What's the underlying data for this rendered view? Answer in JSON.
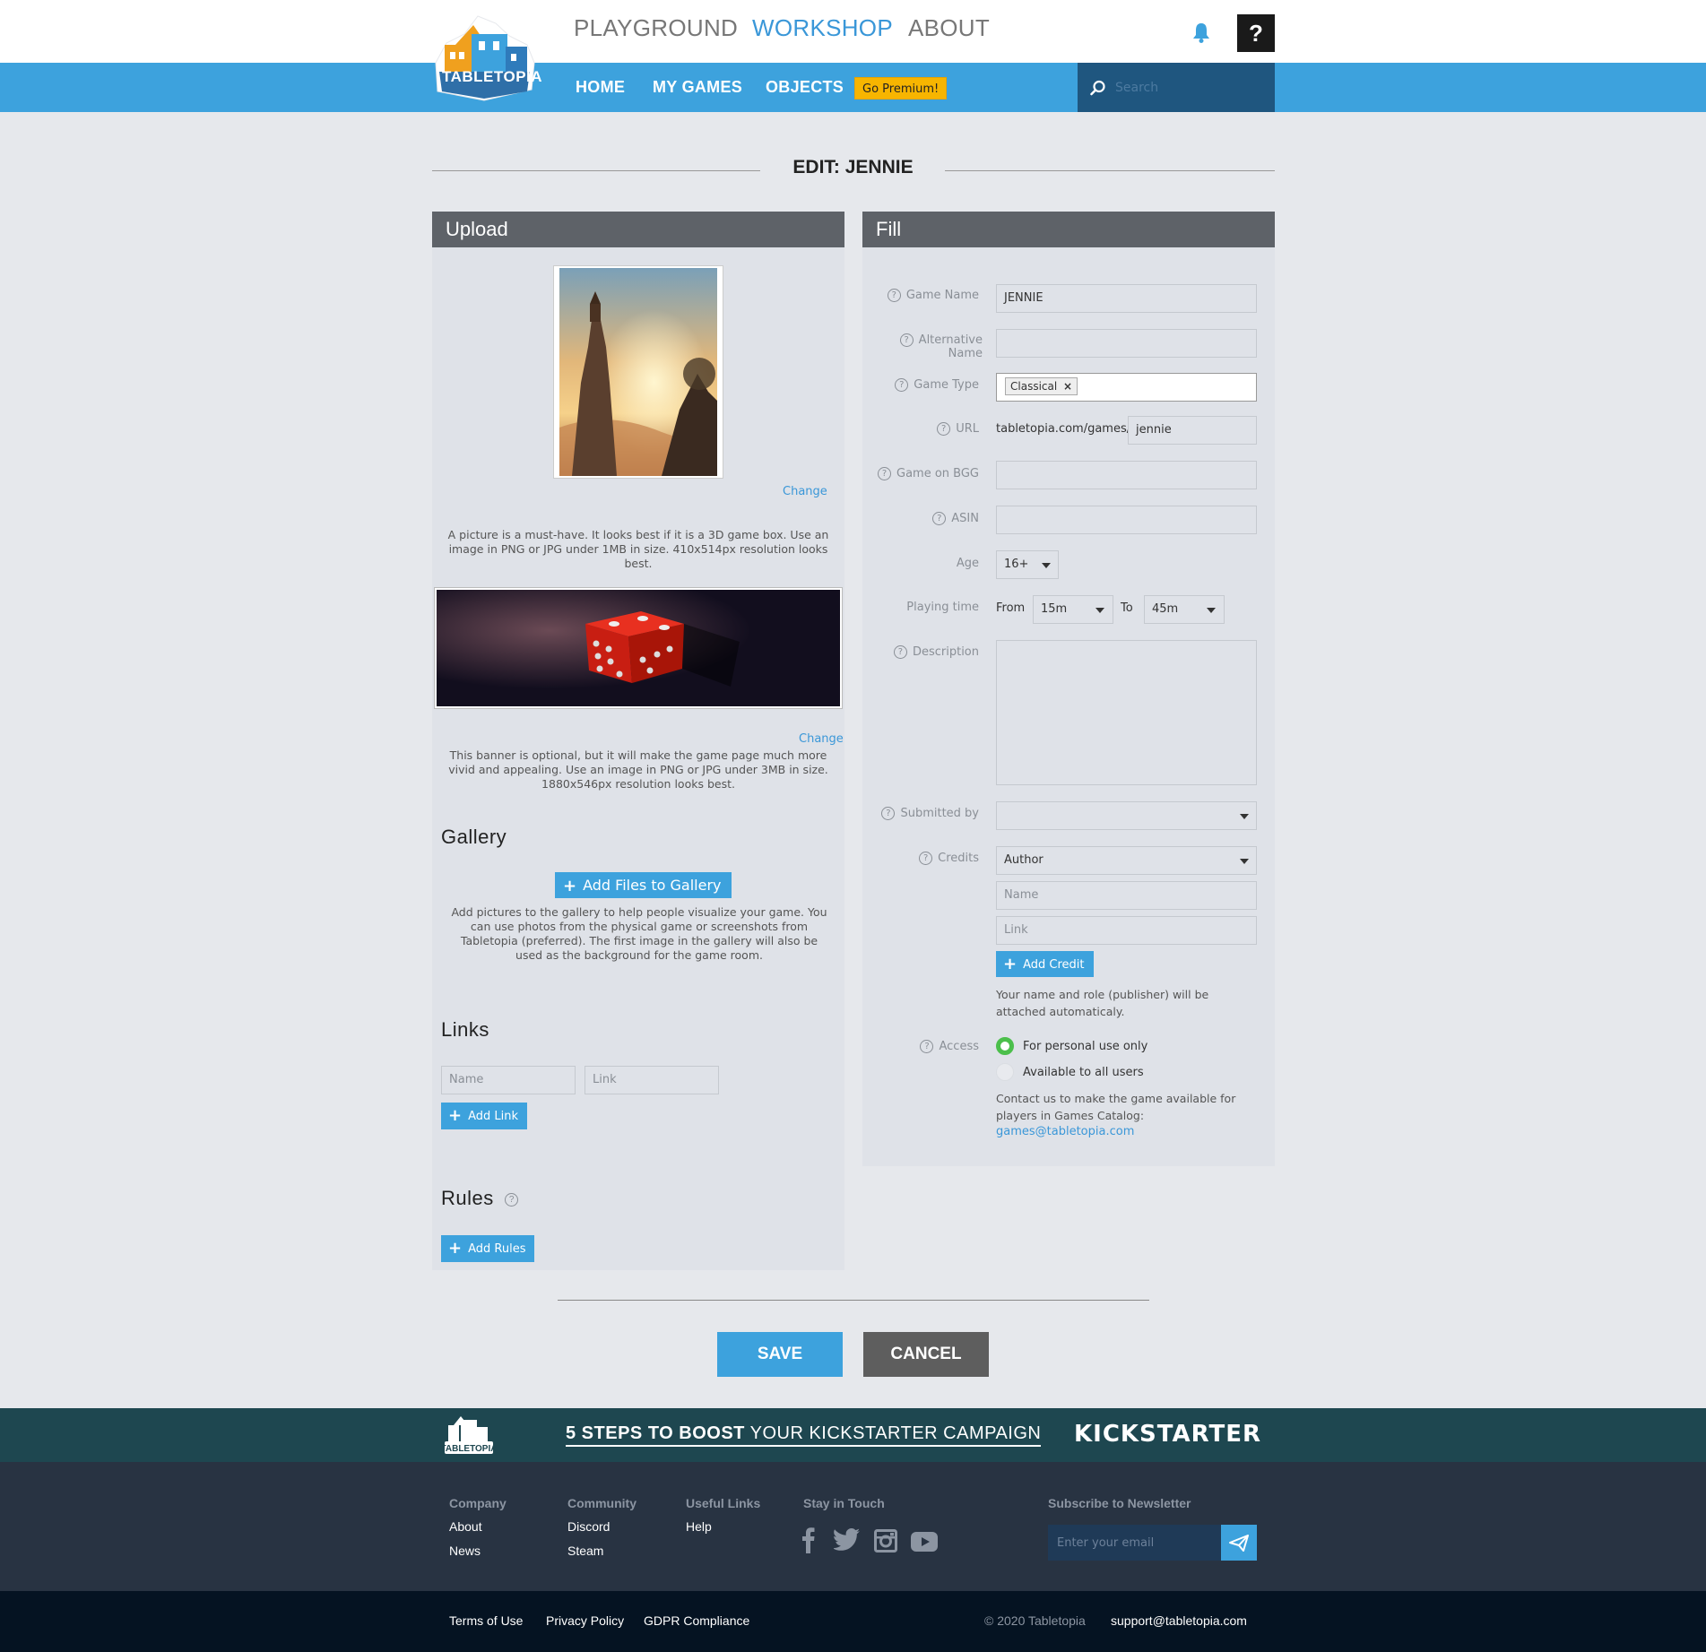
{
  "header": {
    "logo_text": "TABLETOPIA",
    "nav": [
      "PLAYGROUND",
      "WORKSHOP",
      "ABOUT"
    ],
    "active_nav": "WORKSHOP",
    "help_label": "?",
    "subnav": [
      "HOME",
      "MY GAMES",
      "OBJECTS"
    ],
    "premium_label": "Go Premium!",
    "search_placeholder": "Search"
  },
  "page": {
    "title": "EDIT: JENNIE"
  },
  "upload": {
    "heading": "Upload",
    "cover_change": "Change",
    "cover_desc": "A picture is a must-have. It looks best if it is a 3D game box. Use an image in PNG or JPG under 1MB in size. 410x514px resolution looks best.",
    "banner_change": "Change",
    "banner_desc": "This banner is optional, but it will make the game page much more vivid and appealing. Use an image in PNG or JPG under 3MB in size. 1880x546px resolution looks best.",
    "gallery_heading": "Gallery",
    "gallery_button": "Add Files to Gallery",
    "gallery_desc": "Add pictures to the gallery to help people visualize your game. You can use photos from the physical game or screenshots from Tabletopia (preferred). The first image in the gallery will also be used as the background for the game room.",
    "links_heading": "Links",
    "link_name_placeholder": "Name",
    "link_link_placeholder": "Link",
    "add_link": "Add Link",
    "rules_heading": "Rules",
    "add_rules": "Add Rules"
  },
  "fill": {
    "heading": "Fill",
    "labels": {
      "game_name": "Game Name",
      "alt_name": "Alternative Name",
      "game_type": "Game Type",
      "url": "URL",
      "bgg": "Game on BGG",
      "asin": "ASIN",
      "age": "Age",
      "playing_time": "Playing time",
      "description": "Description",
      "submitted_by": "Submitted by",
      "credits": "Credits",
      "access": "Access"
    },
    "game_name": "JENNIE",
    "game_type_tag": "Classical",
    "url_prefix": "tabletopia.com/games/",
    "url_slug": "jennie",
    "age": "16+",
    "time_from_label": "From",
    "time_from": "15m",
    "time_to_label": "To",
    "time_to": "45m",
    "credits_role": "Author",
    "credit_name_placeholder": "Name",
    "credit_link_placeholder": "Link",
    "add_credit": "Add Credit",
    "credit_note": "Your name and role (publisher) will be attached automaticaly.",
    "access_personal": "For personal use only",
    "access_all": "Available to all users",
    "access_note": "Contact us to make the game available for players in Games Catalog:",
    "access_email": "games@tabletopia.com",
    "access_selected": "personal"
  },
  "actions": {
    "save": "SAVE",
    "cancel": "CANCEL"
  },
  "kickstarter": {
    "text_bold": "5 STEPS TO BOOST",
    "text_rest": " YOUR KICKSTARTER CAMPAIGN",
    "logo": "KICKSTARTER"
  },
  "footer": {
    "company": {
      "heading": "Company",
      "links": [
        "About",
        "News"
      ]
    },
    "community": {
      "heading": "Community",
      "links": [
        "Discord",
        "Steam"
      ]
    },
    "useful": {
      "heading": "Useful Links",
      "links": [
        "Help"
      ]
    },
    "social": {
      "heading": "Stay in Touch",
      "icons": [
        "facebook-icon",
        "twitter-icon",
        "instagram-icon",
        "youtube-icon"
      ]
    },
    "newsletter": {
      "heading": "Subscribe to Newsletter",
      "placeholder": "Enter your email"
    }
  },
  "bottom": {
    "links": [
      "Terms of Use",
      "Privacy Policy",
      "GDPR Compliance"
    ],
    "copyright": "© 2020 Tabletopia",
    "support": "support@tabletopia.com"
  },
  "colors": {
    "accent": "#3da2dd",
    "panel_head": "#5e6268",
    "premium": "#f7b500",
    "radio_on": "#4bbf4b"
  }
}
